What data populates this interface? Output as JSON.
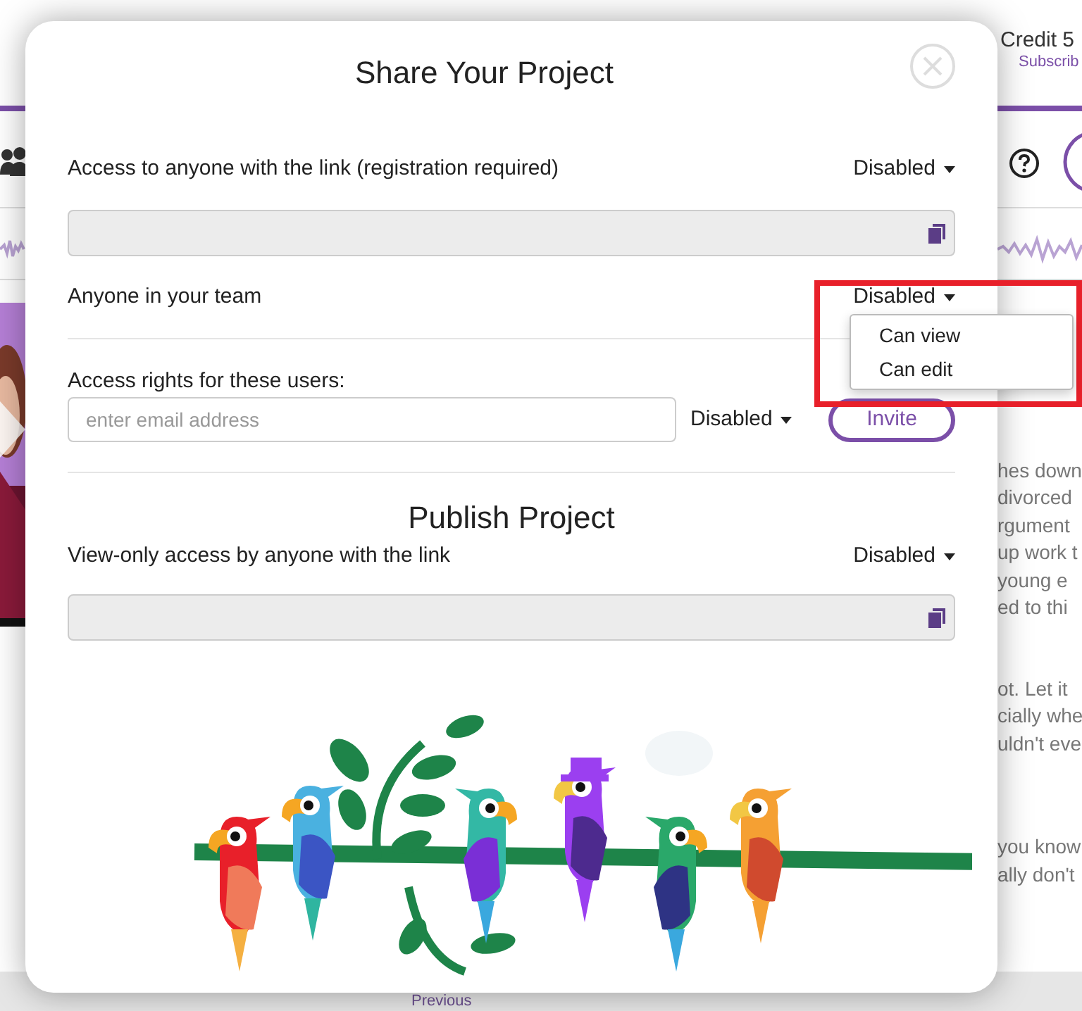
{
  "background": {
    "credit": "Credit 5",
    "subscribe": "Subscrib",
    "text_fragments": [
      [
        "hes down",
        "divorced",
        "rgument",
        "up work t",
        "young e",
        "ed to thi"
      ],
      [
        "ot. Let it",
        "cially whe",
        "uldn't eve"
      ],
      [
        "you know",
        "ally don't"
      ]
    ],
    "pager": "Previous"
  },
  "dialog": {
    "title": "Share Your Project",
    "link_access": {
      "label": "Access to anyone with the link (registration required)",
      "value": "Disabled"
    },
    "team_access": {
      "label": "Anyone in your team",
      "value": "Disabled",
      "expanded": true,
      "options": [
        "Can view",
        "Can edit"
      ]
    },
    "user_access": {
      "label": "Access rights for these users:",
      "placeholder": "enter email address",
      "value": "Disabled",
      "button": "Invite"
    },
    "publish": {
      "title": "Publish Project",
      "label": "View-only access by anyone with the link",
      "value": "Disabled"
    }
  }
}
